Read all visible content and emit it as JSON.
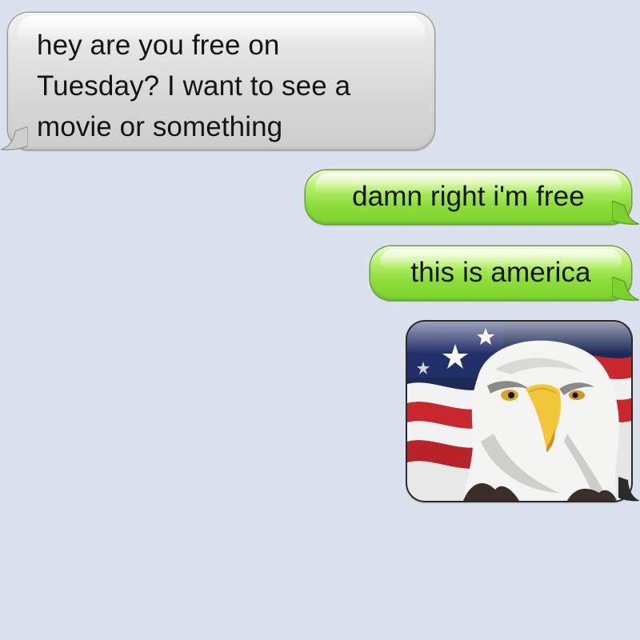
{
  "conversation": {
    "messages": [
      {
        "direction": "incoming",
        "lines": [
          "hey are you free on",
          "Tuesday? I want to see a",
          "movie or something"
        ]
      },
      {
        "direction": "outgoing",
        "text": "damn right i'm free"
      },
      {
        "direction": "outgoing",
        "text": "this is america"
      },
      {
        "direction": "outgoing",
        "type": "image",
        "image_subject": "bald eagle in front of american flag"
      }
    ]
  },
  "colors": {
    "background": "#dbe2ed",
    "incoming_bubble": "#d8d8d8",
    "outgoing_bubble": "#8ddd3a",
    "text": "#141414"
  }
}
